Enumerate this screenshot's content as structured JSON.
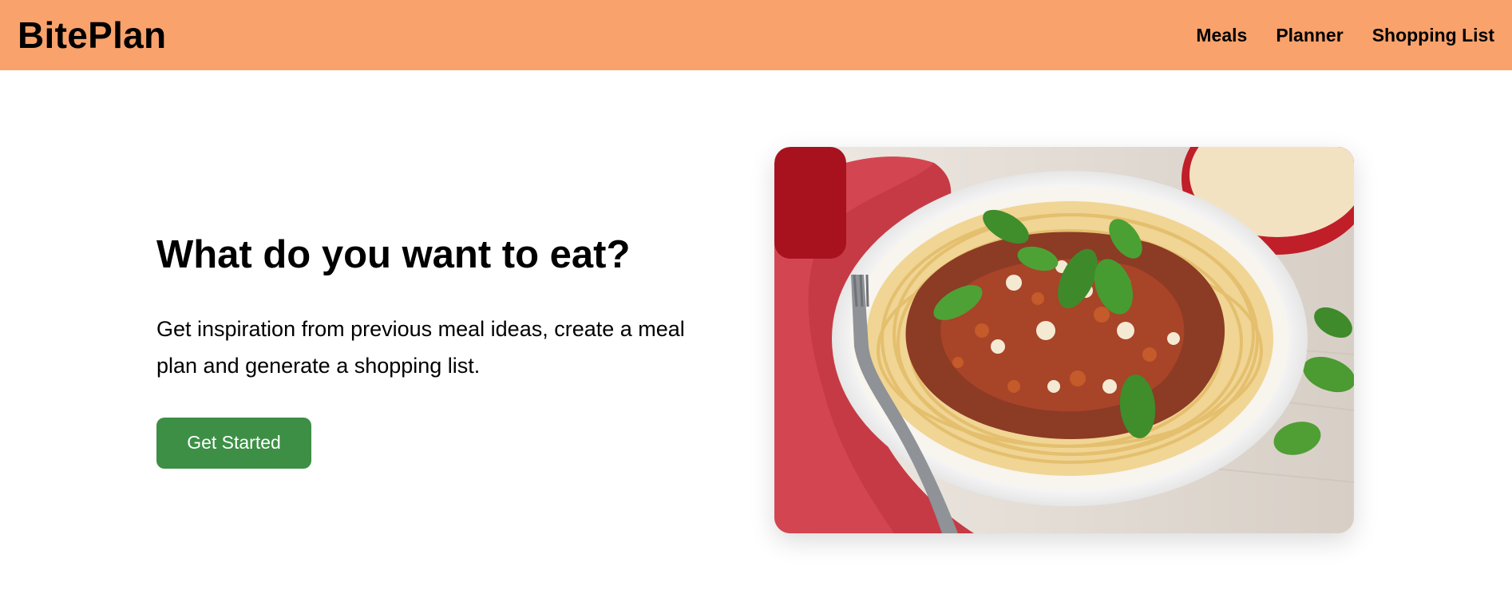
{
  "header": {
    "brand": "BitePlan",
    "nav": [
      "Meals",
      "Planner",
      "Shopping List"
    ]
  },
  "hero": {
    "title": "What do you want to eat?",
    "description": "Get inspiration from previous meal ideas, create a meal plan and generate a shopping list.",
    "cta_label": "Get Started"
  },
  "colors": {
    "header_bg": "#f9a26c",
    "cta_bg": "#3d8f45"
  },
  "image": {
    "subject": "spaghetti-bolognese-photo"
  }
}
